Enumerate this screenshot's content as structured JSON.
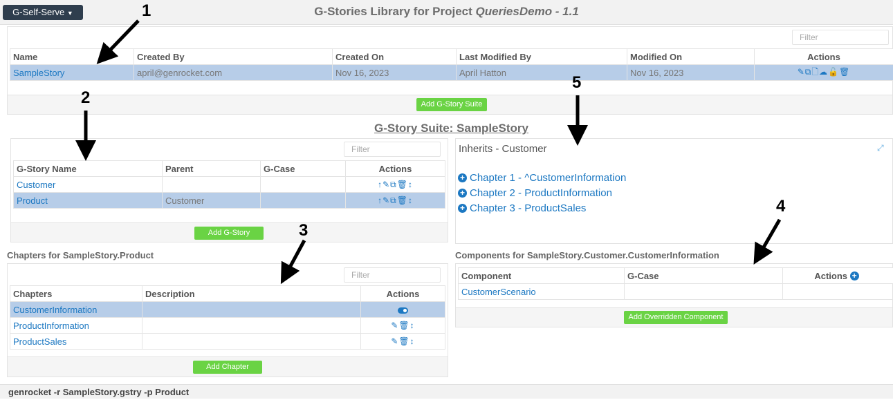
{
  "header": {
    "menu_button": "G-Self-Serve",
    "title_prefix": "G-Stories Library for Project ",
    "title_project": "QueriesDemo - 1.1"
  },
  "library": {
    "filter_placeholder": "Filter",
    "columns": [
      "Name",
      "Created By",
      "Created On",
      "Last Modified By",
      "Modified On",
      "Actions"
    ],
    "rows": [
      {
        "name": "SampleStory",
        "created_by": "april@genrocket.com",
        "created_on": "Nov 16, 2023",
        "last_modified_by": "April Hatton",
        "modified_on": "Nov 16, 2023"
      }
    ],
    "add_button": "Add G-Story Suite"
  },
  "suite": {
    "title": "G-Story Suite: SampleStory"
  },
  "gstories": {
    "filter_placeholder": "Filter",
    "columns": [
      "G-Story Name",
      "Parent",
      "G-Case",
      "Actions"
    ],
    "rows": [
      {
        "name": "Customer",
        "parent": "",
        "gcase": ""
      },
      {
        "name": "Product",
        "parent": "Customer",
        "gcase": ""
      }
    ],
    "add_button": "Add G-Story"
  },
  "inherits": {
    "label": "Inherits - Customer",
    "chapters": [
      "Chapter 1 - ^CustomerInformation",
      "Chapter 2 - ProductInformation",
      "Chapter 3 - ProductSales"
    ]
  },
  "chapters": {
    "label": "Chapters for SampleStory.Product",
    "filter_placeholder": "Filter",
    "columns": [
      "Chapters",
      "Description",
      "Actions"
    ],
    "rows": [
      {
        "name": "CustomerInformation",
        "description": ""
      },
      {
        "name": "ProductInformation",
        "description": ""
      },
      {
        "name": "ProductSales",
        "description": ""
      }
    ],
    "add_button": "Add Chapter"
  },
  "components": {
    "label": "Components for SampleStory.Customer.CustomerInformation",
    "columns": [
      "Component",
      "G-Case",
      "Actions"
    ],
    "rows": [
      {
        "component": "CustomerScenario",
        "gcase": ""
      }
    ],
    "add_button": "Add Overridden Component"
  },
  "command": "genrocket -r SampleStory.gstry -p Product",
  "annotations": [
    "1",
    "2",
    "3",
    "4",
    "5"
  ],
  "colors": {
    "accent": "#1c78c2",
    "selected_row": "#b7cde8",
    "green_button": "#6ad344",
    "dark_button": "#2f3e4e"
  }
}
